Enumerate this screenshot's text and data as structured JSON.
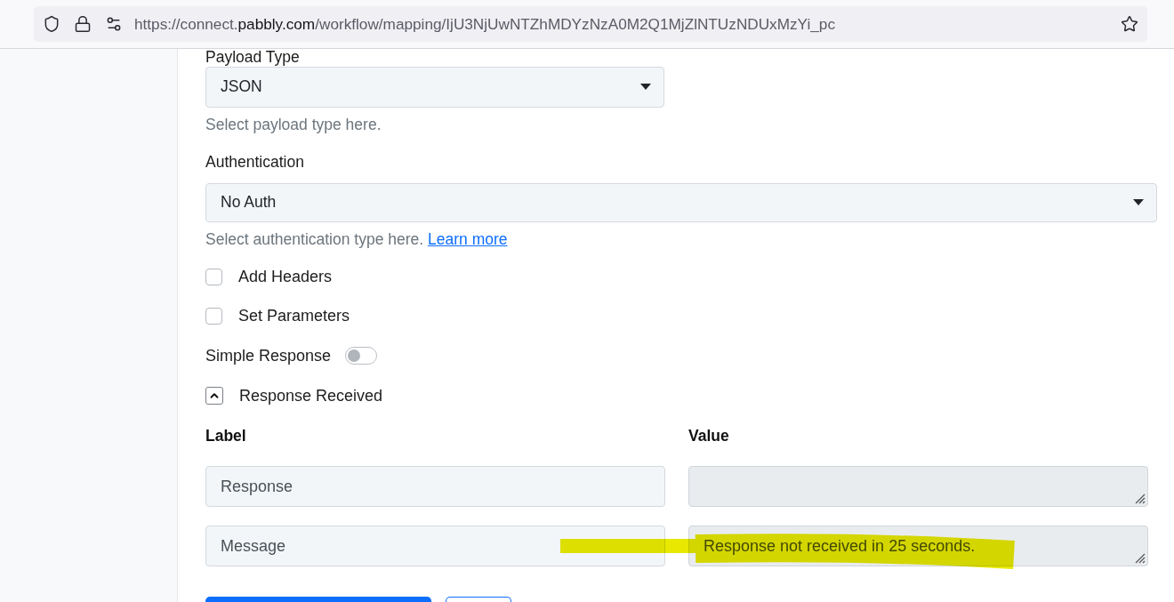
{
  "browser": {
    "url": {
      "before": "https://connect.",
      "domain": "pabbly.com",
      "after": "/workflow/mapping/IjU3NjUwNTZhMDYzNzA0M2Q1MjZlNTUzNDUxMzYi_pc"
    }
  },
  "form": {
    "payload_type": {
      "label": "Payload Type",
      "value": "JSON",
      "help": "Select payload type here."
    },
    "authentication": {
      "label": "Authentication",
      "value": "No Auth",
      "help": "Select authentication type here.",
      "help_link": "Learn more"
    },
    "options": [
      {
        "kind": "checkbox",
        "label": "Add Headers",
        "checked": false
      },
      {
        "kind": "checkbox",
        "label": "Set Parameters",
        "checked": false
      },
      {
        "kind": "toggle",
        "label": "Simple Response",
        "on": false
      }
    ],
    "response_section": {
      "title": "Response Received",
      "expanded": true,
      "columns": [
        "Label",
        "Value"
      ],
      "rows": [
        {
          "label": "Response",
          "value_disabled": true
        },
        {
          "label": "Message",
          "value": "Response not received in 25 seconds.",
          "value_disabled": true
        }
      ]
    },
    "actions": [
      {
        "kind": "primary"
      },
      {
        "kind": "secondary"
      }
    ]
  },
  "annotation": {
    "kind": "highlighter"
  }
}
